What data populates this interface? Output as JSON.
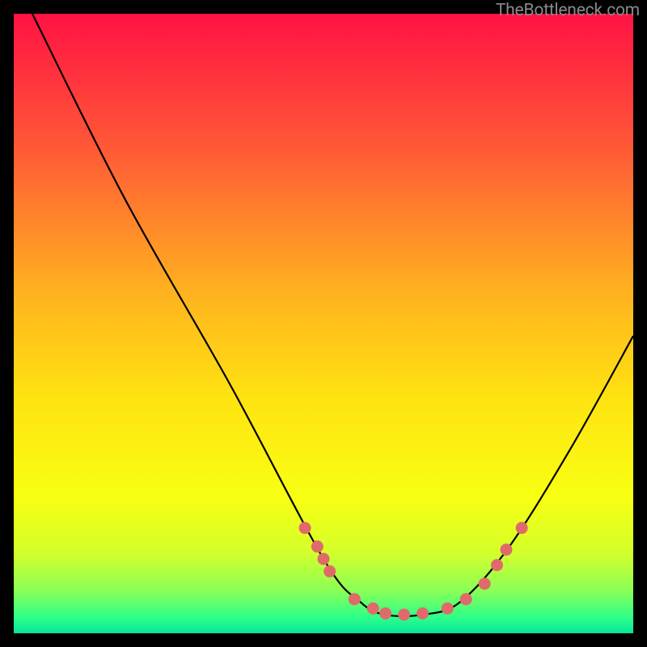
{
  "attribution": "TheBottleneck.com",
  "chart_data": {
    "type": "line",
    "title": "",
    "xlabel": "",
    "ylabel": "",
    "xlim": [
      0,
      100
    ],
    "ylim": [
      0,
      100
    ],
    "background_gradient": {
      "stops": [
        {
          "offset": 0,
          "color": "#ff1244"
        },
        {
          "offset": 0.22,
          "color": "#ff5a36"
        },
        {
          "offset": 0.45,
          "color": "#ffb21f"
        },
        {
          "offset": 0.62,
          "color": "#ffe311"
        },
        {
          "offset": 0.78,
          "color": "#f8ff12"
        },
        {
          "offset": 0.87,
          "color": "#d4ff2b"
        },
        {
          "offset": 0.93,
          "color": "#8cff55"
        },
        {
          "offset": 0.975,
          "color": "#2dff8a"
        },
        {
          "offset": 1.0,
          "color": "#06e59a"
        }
      ]
    },
    "series": [
      {
        "name": "bottleneck-curve",
        "type": "curve",
        "points": [
          {
            "x": 3,
            "y": 100
          },
          {
            "x": 18,
            "y": 70
          },
          {
            "x": 35,
            "y": 40
          },
          {
            "x": 50,
            "y": 12
          },
          {
            "x": 56,
            "y": 5
          },
          {
            "x": 60,
            "y": 3
          },
          {
            "x": 66,
            "y": 3
          },
          {
            "x": 72,
            "y": 5
          },
          {
            "x": 80,
            "y": 14
          },
          {
            "x": 90,
            "y": 30
          },
          {
            "x": 100,
            "y": 48
          }
        ]
      },
      {
        "name": "markers",
        "type": "scatter",
        "points": [
          {
            "x": 47,
            "y": 17
          },
          {
            "x": 49,
            "y": 14
          },
          {
            "x": 50,
            "y": 12
          },
          {
            "x": 51,
            "y": 10
          },
          {
            "x": 55,
            "y": 5.5
          },
          {
            "x": 58,
            "y": 4
          },
          {
            "x": 60,
            "y": 3.2
          },
          {
            "x": 63,
            "y": 3
          },
          {
            "x": 66,
            "y": 3.2
          },
          {
            "x": 70,
            "y": 4
          },
          {
            "x": 73,
            "y": 5.5
          },
          {
            "x": 76,
            "y": 8
          },
          {
            "x": 78,
            "y": 11
          },
          {
            "x": 79.5,
            "y": 13.5
          },
          {
            "x": 82,
            "y": 17
          }
        ]
      }
    ],
    "colors": {
      "curve": "#000000",
      "marker_fill": "#e06a6a",
      "marker_stroke": "#b94a4a"
    }
  }
}
